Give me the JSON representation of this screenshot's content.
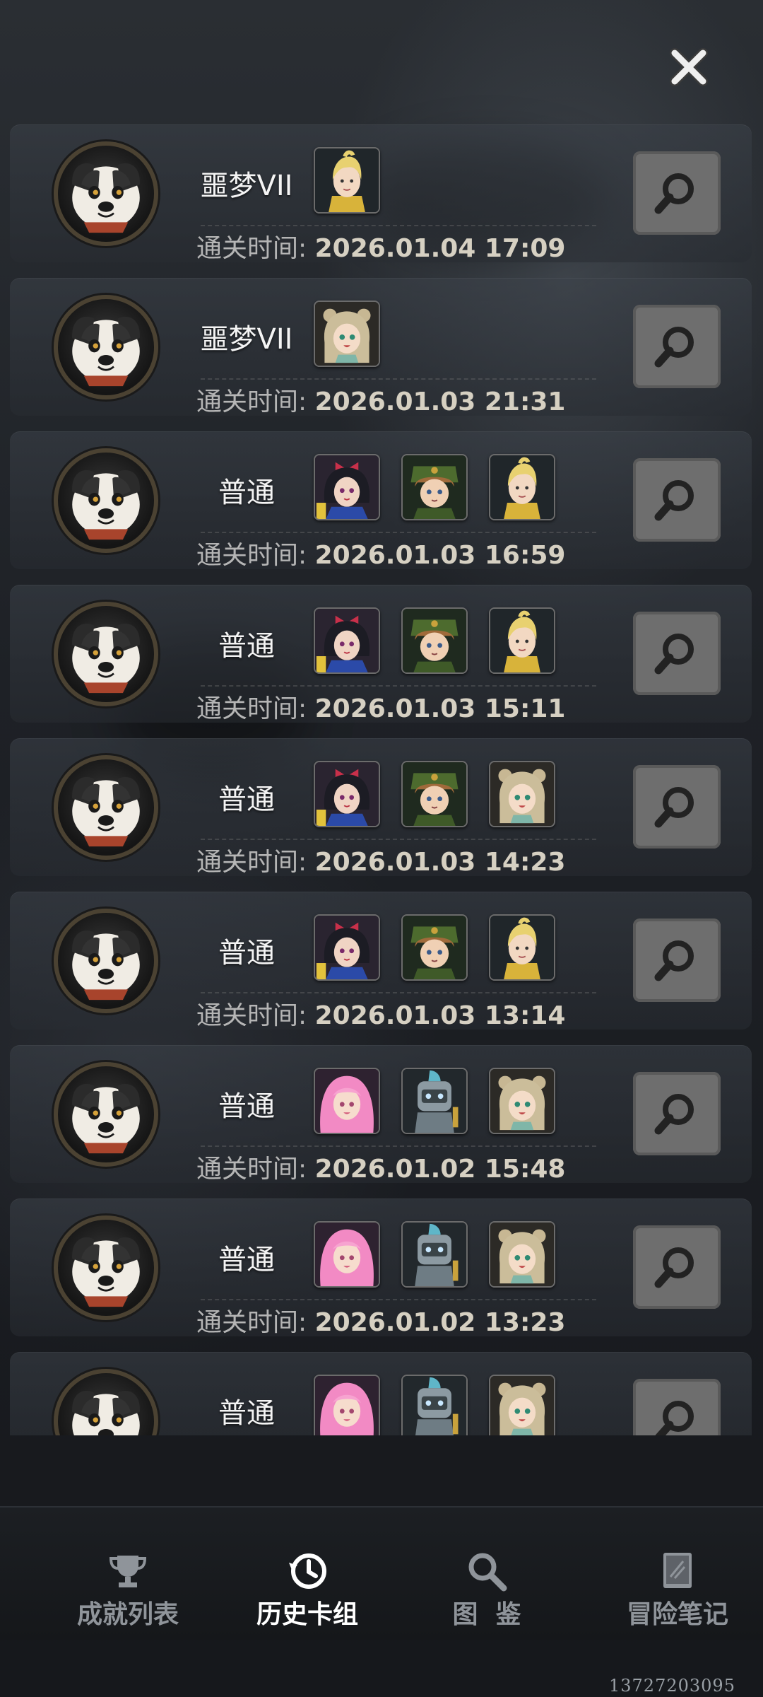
{
  "close_button": {
    "icon": "close-icon"
  },
  "records": [
    {
      "mode": "噩梦VII",
      "cards": [
        "blonde-prince"
      ],
      "time_label": "通关时间:",
      "time_value": "2026.01.04 17:09"
    },
    {
      "mode": "噩梦VII",
      "cards": [
        "bear-girl"
      ],
      "time_label": "通关时间:",
      "time_value": "2026.01.03 21:31"
    },
    {
      "mode": "普通",
      "cards": [
        "bow-girl",
        "soldier-boy",
        "blonde-prince"
      ],
      "time_label": "通关时间:",
      "time_value": "2026.01.03 16:59"
    },
    {
      "mode": "普通",
      "cards": [
        "bow-girl",
        "soldier-boy",
        "blonde-prince"
      ],
      "time_label": "通关时间:",
      "time_value": "2026.01.03 15:11"
    },
    {
      "mode": "普通",
      "cards": [
        "bow-girl",
        "soldier-boy",
        "bear-girl"
      ],
      "time_label": "通关时间:",
      "time_value": "2026.01.03 14:23"
    },
    {
      "mode": "普通",
      "cards": [
        "bow-girl",
        "soldier-boy",
        "blonde-prince"
      ],
      "time_label": "通关时间:",
      "time_value": "2026.01.03 13:14"
    },
    {
      "mode": "普通",
      "cards": [
        "pink-hair-girl",
        "robot-knight",
        "bear-girl"
      ],
      "time_label": "通关时间:",
      "time_value": "2026.01.02 15:48"
    },
    {
      "mode": "普通",
      "cards": [
        "pink-hair-girl",
        "robot-knight",
        "bear-girl"
      ],
      "time_label": "通关时间:",
      "time_value": "2026.01.02 13:23"
    },
    {
      "mode": "普通",
      "cards": [
        "pink-hair-girl",
        "robot-knight",
        "bear-girl"
      ],
      "time_label": "",
      "time_value": ""
    }
  ],
  "bottom_nav": {
    "items": [
      {
        "label": "成就列表",
        "icon": "trophy-icon",
        "active": false
      },
      {
        "label": "历史卡组",
        "icon": "history-icon",
        "active": true
      },
      {
        "label": "图  鉴",
        "icon": "magnifier-icon",
        "active": false
      },
      {
        "label": "冒险笔记",
        "icon": "notebook-icon",
        "active": false
      }
    ]
  },
  "watermark": "13727203095",
  "colors": {
    "accent_gold": "#d6d0c2",
    "muted_text": "#b5b5b5",
    "button_gray": "#6e6e6e"
  }
}
